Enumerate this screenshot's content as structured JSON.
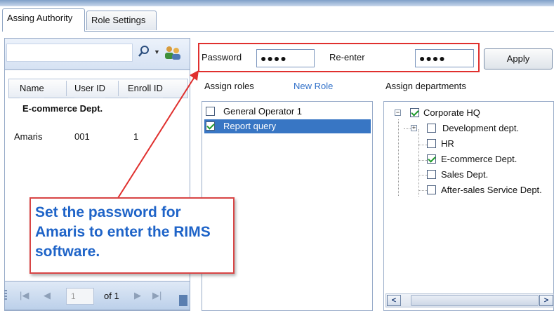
{
  "tabs": [
    {
      "label": "Assing Authority",
      "active": true
    },
    {
      "label": "Role Settings",
      "active": false
    }
  ],
  "left_panel": {
    "search": {
      "value": "",
      "placeholder": ""
    },
    "columns": [
      "Name",
      "User ID",
      "Enroll ID"
    ],
    "group": "E-commerce Dept.",
    "rows": [
      {
        "name": "Amaris",
        "user_id": "001",
        "enroll_id": "1"
      }
    ],
    "pager": {
      "current_page": "1",
      "of_text": "of 1"
    }
  },
  "password_row": {
    "password_label": "Password",
    "password_value": "●●●●",
    "reenter_label": "Re-enter",
    "reenter_value": "●●●●",
    "apply_label": "Apply"
  },
  "roles": {
    "section_label": "Assign roles",
    "new_role_label": "New Role",
    "items": [
      {
        "label": "General Operator 1",
        "checked": false,
        "selected": false
      },
      {
        "label": "Report query",
        "checked": true,
        "selected": true
      }
    ]
  },
  "departments": {
    "section_label": "Assign departments",
    "tree": [
      {
        "label": "Corporate HQ",
        "checked": true,
        "level": 0,
        "expander": "−"
      },
      {
        "label": "Development dept.",
        "checked": false,
        "level": 1,
        "expander": "+"
      },
      {
        "label": "HR",
        "checked": false,
        "level": 1
      },
      {
        "label": "E-commerce Dept.",
        "checked": true,
        "level": 1
      },
      {
        "label": "Sales Dept.",
        "checked": false,
        "level": 1
      },
      {
        "label": "After-sales Service Dept.",
        "checked": false,
        "level": 1
      }
    ]
  },
  "callout": {
    "text": "Set the password for Amaris to enter the RIMS software."
  },
  "colors": {
    "accent_blue": "#3876c4",
    "callout_text": "#1f64c8",
    "callout_border": "#d84545",
    "highlight_red": "#e0302e",
    "check_green": "#1d9a2a"
  }
}
